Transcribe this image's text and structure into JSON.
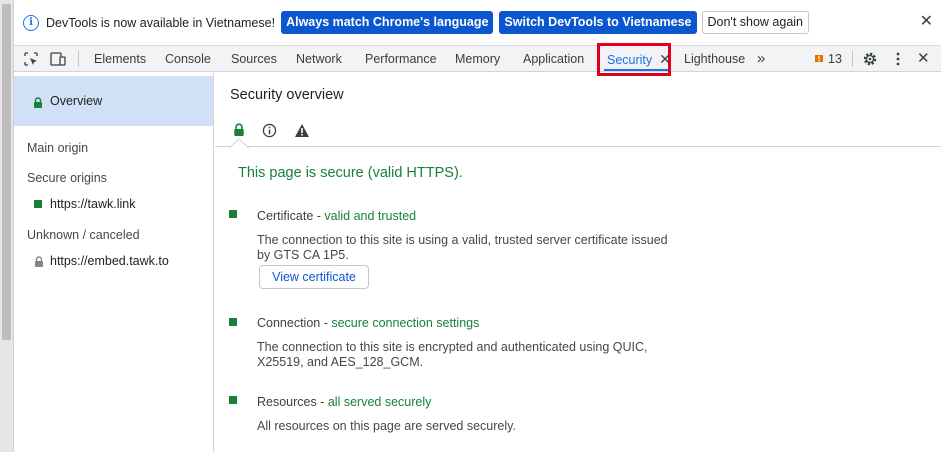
{
  "infobar": {
    "message": "DevTools is now available in Vietnamese!",
    "btn_match": "Always match Chrome's language",
    "btn_switch": "Switch DevTools to Vietnamese",
    "btn_dismiss": "Don't show again",
    "icon": "info-icon"
  },
  "tabs": {
    "items": [
      "Elements",
      "Console",
      "Sources",
      "Network",
      "Performance",
      "Memory",
      "Application",
      "Security",
      "Lighthouse"
    ],
    "active": "Security",
    "more": "»",
    "issues_count": "13"
  },
  "sidebar": {
    "overview": "Overview",
    "main_origin": "Main origin",
    "secure_origins": "Secure origins",
    "secure_item": "https://tawk.link",
    "unknown": "Unknown / canceled",
    "unknown_item": "https://embed.tawk.to"
  },
  "main": {
    "title": "Security overview",
    "headline": "This page is secure (valid HTTPS).",
    "certificate": {
      "label": "Certificate - ",
      "status": "valid and trusted",
      "desc": "The connection to this site is using a valid, trusted server certificate issued by GTS CA 1P5.",
      "button": "View certificate"
    },
    "connection": {
      "label": "Connection - ",
      "status": "secure connection settings",
      "desc": "The connection to this site is encrypted and authenticated using QUIC, X25519, and AES_128_GCM."
    },
    "resources": {
      "label": "Resources - ",
      "status": "all served securely",
      "desc": "All resources on this page are served securely."
    }
  },
  "colors": {
    "accent": "#1a73e8",
    "secure_green": "#188038",
    "primary_button": "#0b57d0",
    "highlight_red": "#e0001b",
    "selected_bg": "#cfe0f7"
  }
}
